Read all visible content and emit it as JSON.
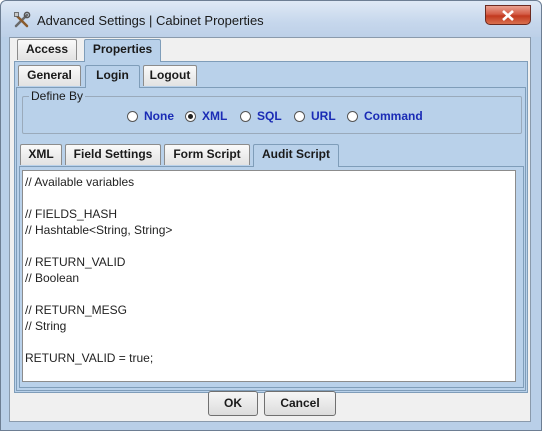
{
  "window": {
    "title": "Advanced Settings | Cabinet Properties",
    "app_icon": "tools-icon",
    "close_icon": "close-icon"
  },
  "top_tabs": [
    {
      "label": "Access",
      "selected": false
    },
    {
      "label": "Properties",
      "selected": true
    }
  ],
  "sub_tabs": [
    {
      "label": "General",
      "selected": false
    },
    {
      "label": "Login",
      "selected": true
    },
    {
      "label": "Logout",
      "selected": false
    }
  ],
  "define_by": {
    "title": "Define By",
    "options": [
      {
        "label": "None",
        "selected": false
      },
      {
        "label": "XML",
        "selected": true
      },
      {
        "label": "SQL",
        "selected": false
      },
      {
        "label": "URL",
        "selected": false
      },
      {
        "label": "Command",
        "selected": false
      }
    ]
  },
  "script_tabs": [
    {
      "label": "XML",
      "selected": false
    },
    {
      "label": "Field Settings",
      "selected": false
    },
    {
      "label": "Form Script",
      "selected": false
    },
    {
      "label": "Audit Script",
      "selected": true
    }
  ],
  "editor": {
    "lines": [
      "// Available variables",
      "",
      "// FIELDS_HASH",
      "// Hashtable<String, String>",
      "",
      "// RETURN_VALID",
      "// Boolean",
      "",
      "// RETURN_MESG",
      "// String",
      "",
      "RETURN_VALID = true;"
    ]
  },
  "buttons": {
    "ok": "OK",
    "cancel": "Cancel"
  },
  "colors": {
    "radio_label": "#1a2bb5",
    "selected_tab": "#b9d1ea",
    "close_button": "#c2391f"
  }
}
